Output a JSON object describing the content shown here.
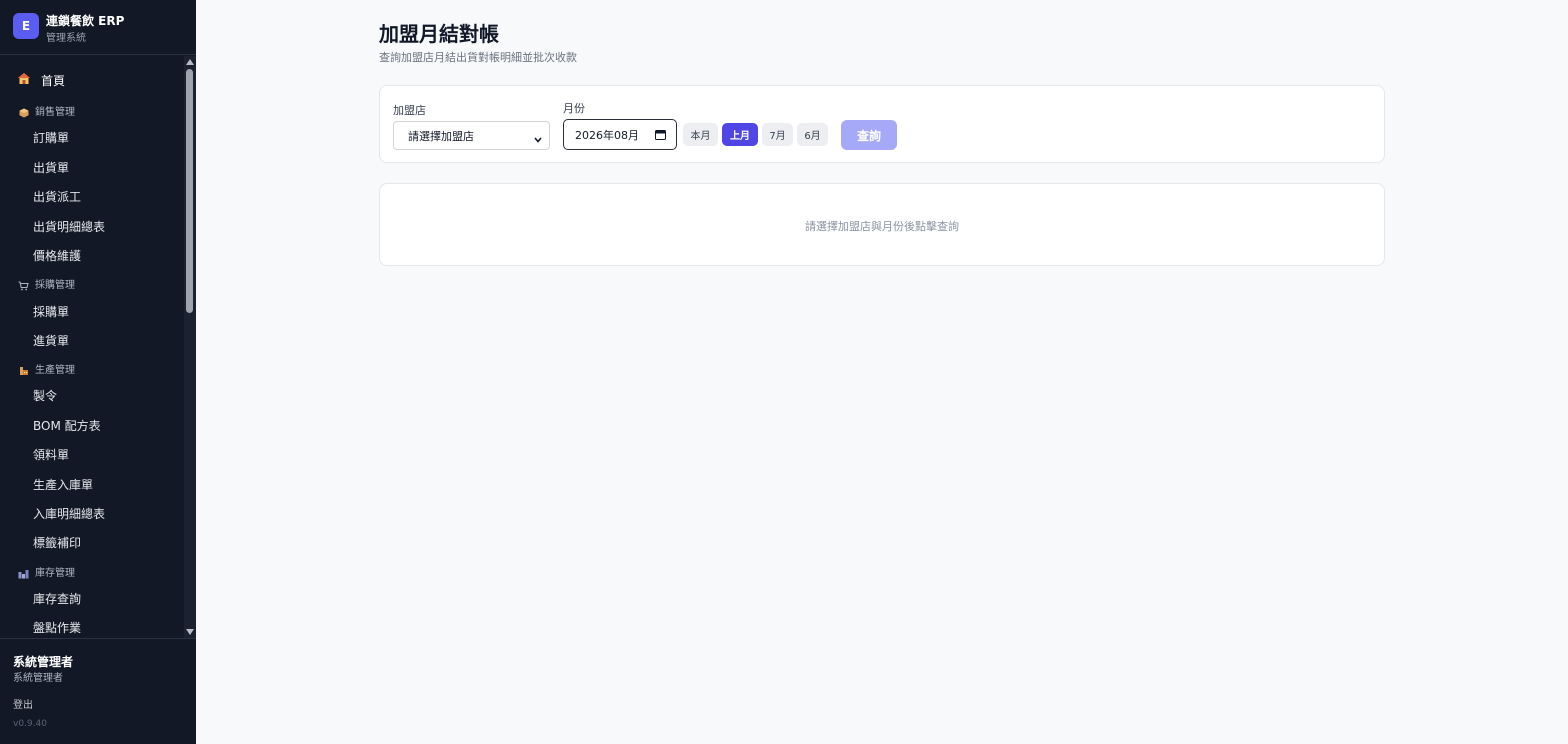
{
  "brand": {
    "logo_letter": "E",
    "title": "連鎖餐飲 ERP",
    "subtitle": "管理系統"
  },
  "nav": {
    "home": {
      "icon": "home-icon",
      "label": "首頁"
    },
    "sections": [
      {
        "icon": "box-icon",
        "label": "銷售管理",
        "items": [
          "訂購單",
          "出貨單",
          "出貨派工",
          "出貨明細總表",
          "價格維護"
        ]
      },
      {
        "icon": "cart-icon",
        "label": "採購管理",
        "items": [
          "採購單",
          "進貨單"
        ]
      },
      {
        "icon": "factory-icon",
        "label": "生產管理",
        "items": [
          "製令",
          "BOM 配方表",
          "領料單",
          "生產入庫單",
          "入庫明細總表",
          "標籤補印"
        ]
      },
      {
        "icon": "warehouse-icon",
        "label": "庫存管理",
        "items": [
          "庫存查詢",
          "盤點作業"
        ]
      }
    ]
  },
  "user": {
    "name": "系統管理者",
    "role": "系統管理者",
    "logout_label": "登出",
    "version": "v0.9.40"
  },
  "page": {
    "title": "加盟月結對帳",
    "subtitle": "查詢加盟店月結出貨對帳明細並批次收款"
  },
  "filters": {
    "store_label": "加盟店",
    "store_value": "請選擇加盟店",
    "month_label": "月份",
    "month_value": "2026年08月",
    "quick_months": [
      {
        "label": "本月",
        "active": false
      },
      {
        "label": "上月",
        "active": true
      },
      {
        "label": "7月",
        "active": false
      },
      {
        "label": "6月",
        "active": false
      }
    ],
    "query_label": "查詢"
  },
  "result": {
    "empty_message": "請選擇加盟店與月份後點擊查詢"
  },
  "colors": {
    "sidebar_bg": "#131826",
    "accent": "#4f46e5",
    "query_disabled": "#a5a9f7"
  }
}
